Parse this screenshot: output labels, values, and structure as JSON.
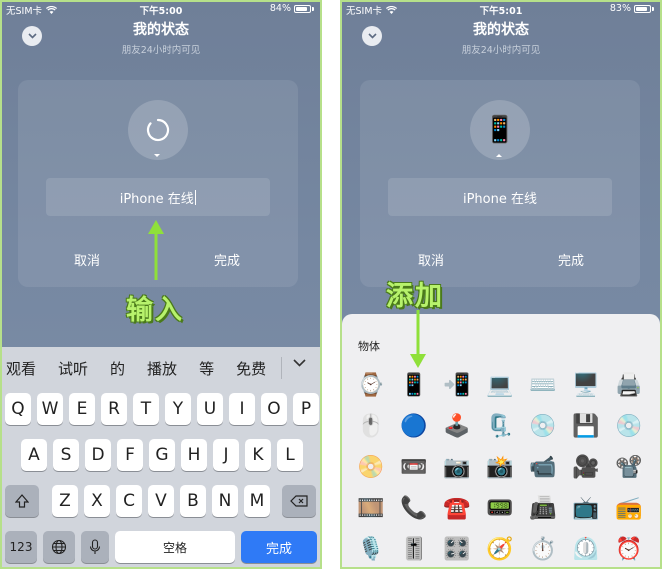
{
  "status_bar": {
    "left": {
      "carrier": "无SIM卡",
      "time": "下午5:00",
      "battery": "84%",
      "battery_level": 0.84
    },
    "right": {
      "carrier": "无SIM卡",
      "time": "下午5:01",
      "battery": "83%",
      "battery_level": 0.83
    }
  },
  "header": {
    "title": "我的状态",
    "subtitle": "朋友24小时内可见"
  },
  "card": {
    "input_value": "iPhone 在线",
    "cancel_label": "取消",
    "done_label": "完成"
  },
  "annotations": {
    "input_label": "输入",
    "add_label": "添加"
  },
  "keyboard": {
    "candidates": [
      "观看",
      "试听",
      "的",
      "播放",
      "等",
      "免费"
    ],
    "row1": [
      "Q",
      "W",
      "E",
      "R",
      "T",
      "Y",
      "U",
      "I",
      "O",
      "P"
    ],
    "row2": [
      "A",
      "S",
      "D",
      "F",
      "G",
      "H",
      "J",
      "K",
      "L"
    ],
    "row3": [
      "Z",
      "X",
      "C",
      "V",
      "B",
      "N",
      "M"
    ],
    "numbers_key": "123",
    "space_label": "空格",
    "done_label": "完成"
  },
  "emoji_panel": {
    "section_title": "物体",
    "rows": [
      [
        "⌚",
        "📱",
        "📲",
        "💻",
        "⌨️",
        "🖥️",
        "🖨️"
      ],
      [
        "🖱️",
        "🔵",
        "🕹️",
        "🗜️",
        "💿",
        "💾",
        "💿"
      ],
      [
        "📀",
        "📼",
        "📷",
        "📸",
        "📹",
        "🎥",
        "📽️"
      ],
      [
        "🎞️",
        "📞",
        "☎️",
        "📟",
        "📠",
        "📺",
        "📻"
      ],
      [
        "🎙️",
        "🎚️",
        "🎛️",
        "🧭",
        "⏱️",
        "⏲️",
        "⏰"
      ]
    ]
  },
  "colors": {
    "accent_blue": "#2f7af6",
    "annotation_green": "#b7f26c",
    "frame_green": "#b6e08a"
  }
}
